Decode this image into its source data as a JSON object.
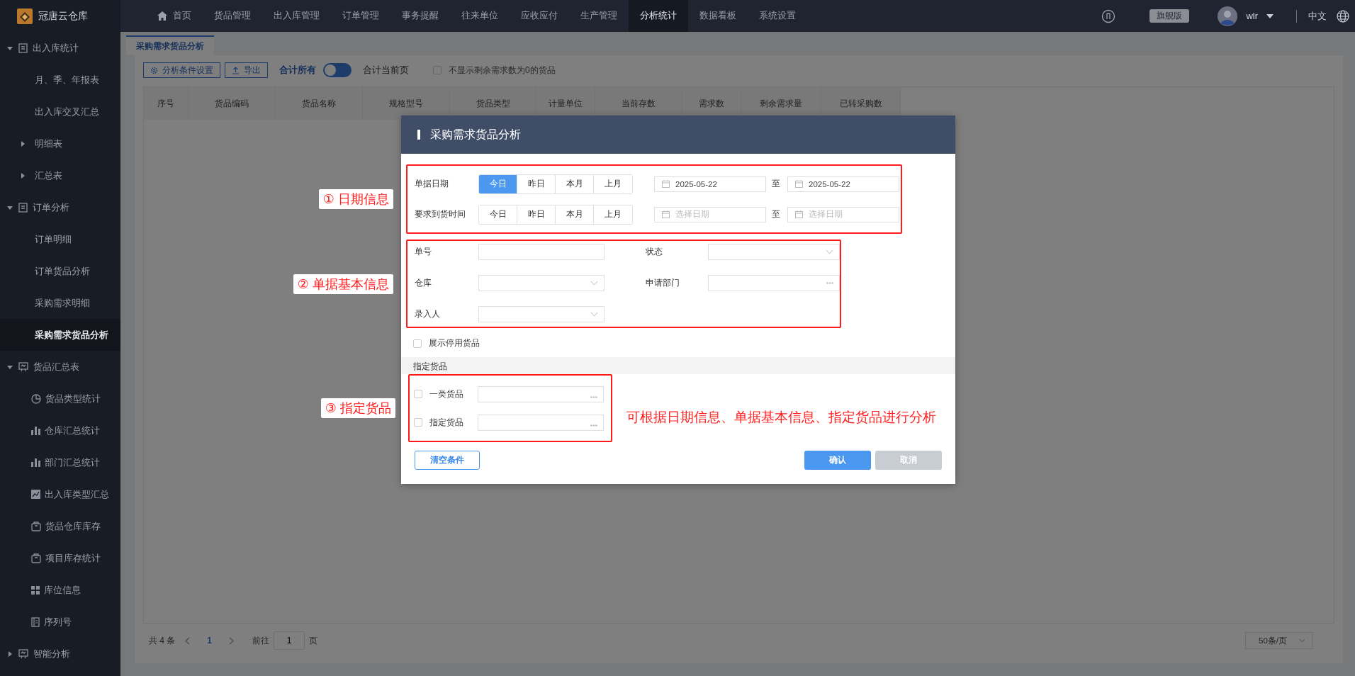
{
  "app": {
    "name": "冠唐云仓库"
  },
  "top_nav": [
    {
      "label": "首页",
      "selected": false
    },
    {
      "label": "货品管理",
      "selected": false
    },
    {
      "label": "出入库管理",
      "selected": false
    },
    {
      "label": "订单管理",
      "selected": false
    },
    {
      "label": "事务提醒",
      "selected": false
    },
    {
      "label": "往来单位",
      "selected": false
    },
    {
      "label": "应收应付",
      "selected": false
    },
    {
      "label": "生产管理",
      "selected": false
    },
    {
      "label": "分析统计",
      "selected": true
    },
    {
      "label": "数据看板",
      "selected": false
    },
    {
      "label": "系统设置",
      "selected": false
    }
  ],
  "user_area": {
    "edition": "旗舰版",
    "user": "wlr",
    "language": "中文"
  },
  "sidebar": {
    "items": [
      {
        "kind": "group",
        "label": "出入库统计",
        "expanded": true,
        "children": [
          {
            "kind": "link",
            "label": "月、季、年报表",
            "selected": false
          },
          {
            "kind": "link",
            "label": "出入库交叉汇总",
            "selected": false
          },
          {
            "kind": "folder",
            "label": "明细表",
            "expanded": false
          },
          {
            "kind": "folder",
            "label": "汇总表",
            "expanded": false
          }
        ]
      },
      {
        "kind": "group",
        "label": "订单分析",
        "expanded": true,
        "children": [
          {
            "kind": "link",
            "label": "订单明细",
            "selected": false
          },
          {
            "kind": "link",
            "label": "订单货品分析",
            "selected": false
          },
          {
            "kind": "link",
            "label": "采购需求明细",
            "selected": false
          },
          {
            "kind": "link",
            "label": "采购需求货品分析",
            "selected": true
          }
        ]
      },
      {
        "kind": "group",
        "label": "货品汇总表",
        "expanded": true,
        "children": [
          {
            "kind": "icon-link",
            "label": "货品类型统计",
            "selected": false
          },
          {
            "kind": "icon-link",
            "label": "仓库汇总统计",
            "selected": false
          },
          {
            "kind": "icon-link",
            "label": "部门汇总统计",
            "selected": false
          },
          {
            "kind": "icon-link",
            "label": "出入库类型汇总",
            "selected": false
          },
          {
            "kind": "icon-link",
            "label": "货品仓库库存",
            "selected": false
          },
          {
            "kind": "icon-link",
            "label": "项目库存统计",
            "selected": false
          },
          {
            "kind": "icon-link",
            "label": "库位信息",
            "selected": false
          },
          {
            "kind": "icon-link",
            "label": "序列号",
            "selected": false
          }
        ]
      },
      {
        "kind": "group",
        "label": "智能分析",
        "expanded": false
      }
    ]
  },
  "page_tabs": [
    {
      "label": "采购需求货品分析",
      "selected": true
    }
  ],
  "toolbar": {
    "buttons": [
      "分析条件设置",
      "导出"
    ],
    "switch": {
      "left_label": "合计所有",
      "right_label": "合计当前页",
      "on": false
    },
    "filter": {
      "label": "不显示剩余需求数为0的货品",
      "checked": false
    }
  },
  "table": {
    "columns": [
      "序号",
      "货品编码",
      "货品名称",
      "规格型号",
      "货品类型",
      "计量单位",
      "当前存数",
      "需求数",
      "剩余需求量",
      "已转采购数"
    ]
  },
  "pagination": {
    "total": "共 4 条",
    "current_page": "1",
    "goto_label": "前往",
    "goto_value": "1",
    "page_suffix": "页",
    "page_size": "50条/页"
  },
  "dialog": {
    "title": "采购需求货品分析",
    "date_section": {
      "annotation": "① 日期信息",
      "rows": [
        {
          "label": "单据日期",
          "quick": [
            {
              "label": "今日",
              "selected": true
            },
            {
              "label": "昨日",
              "selected": false
            },
            {
              "label": "本月",
              "selected": false
            },
            {
              "label": "上月",
              "selected": false
            }
          ],
          "from": {
            "value": "2025-05-22"
          },
          "sep": "至",
          "to": {
            "value": "2025-05-22"
          }
        },
        {
          "label": "要求到货时间",
          "quick": [
            {
              "label": "今日",
              "selected": false
            },
            {
              "label": "昨日",
              "selected": false
            },
            {
              "label": "本月",
              "selected": false
            },
            {
              "label": "上月",
              "selected": false
            }
          ],
          "from": {
            "placeholder": "选择日期"
          },
          "sep": "至",
          "to": {
            "placeholder": "选择日期"
          }
        }
      ]
    },
    "basic_section": {
      "annotation": "② 单据基本信息",
      "fields": [
        {
          "label": "单号",
          "kind": "text"
        },
        {
          "label": "状态",
          "kind": "select"
        },
        {
          "label": "仓库",
          "kind": "select"
        },
        {
          "label": "申请部门",
          "kind": "picker"
        },
        {
          "label": "录入人",
          "kind": "select"
        }
      ]
    },
    "show_disabled": {
      "label": "展示停用货品",
      "checked": false
    },
    "goods_heading": "指定货品",
    "goods_section": {
      "annotation": "③ 指定货品",
      "rows": [
        {
          "label": "一类货品",
          "checked": false
        },
        {
          "label": "指定货品",
          "checked": false
        }
      ]
    },
    "note": "可根据日期信息、单据基本信息、指定货品进行分析",
    "buttons": {
      "clear": "清空条件",
      "confirm": "确认",
      "cancel": "取消"
    }
  }
}
